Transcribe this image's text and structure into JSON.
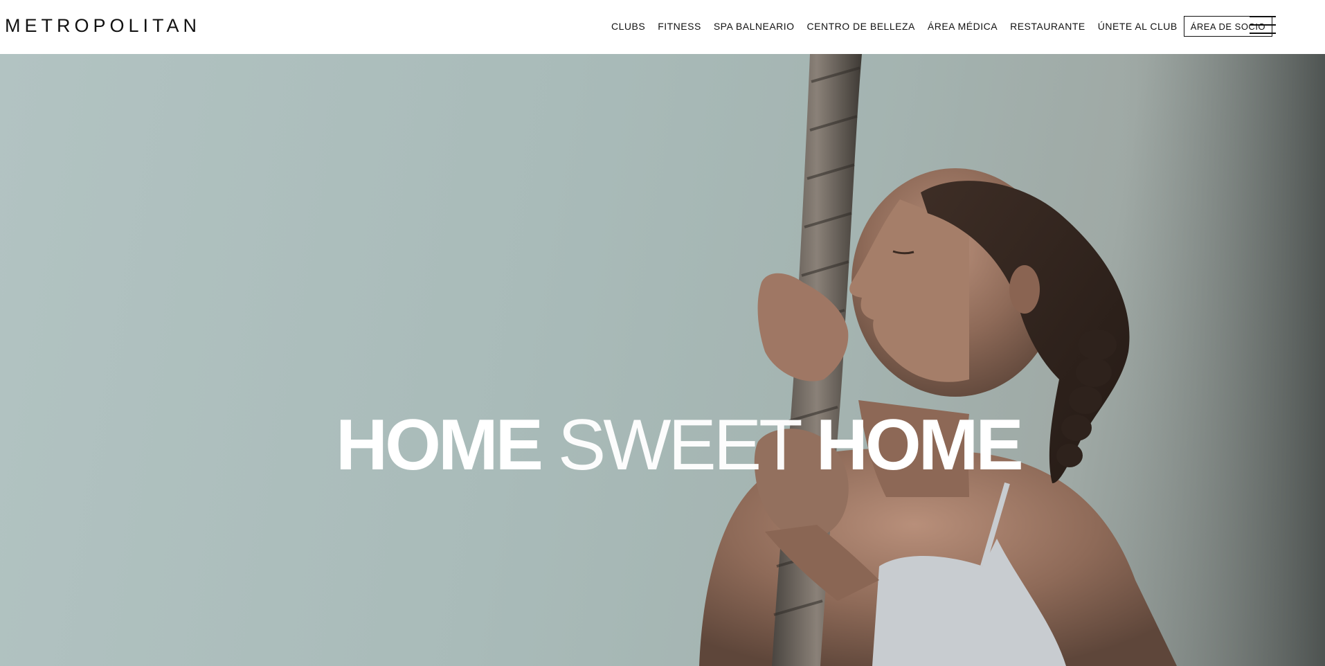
{
  "header": {
    "logo": "METROPOLITAN",
    "nav": [
      "CLUBS",
      "FITNESS",
      "SPA BALNEARIO",
      "CENTRO DE BELLEZA",
      "ÁREA MÉDICA",
      "RESTAURANTE",
      "ÚNETE AL CLUB"
    ],
    "member_button": "ÁREA DE SOCIO",
    "menu_icon": "hamburger-menu-icon"
  },
  "hero": {
    "title_part1": "HOME",
    "title_part2": "SWEET",
    "title_part3": "HOME",
    "image": "woman-with-climbing-rope-photo"
  },
  "colors": {
    "text": "#111111",
    "hero_text": "#ffffff",
    "hero_bg": "#a9bbb9"
  }
}
